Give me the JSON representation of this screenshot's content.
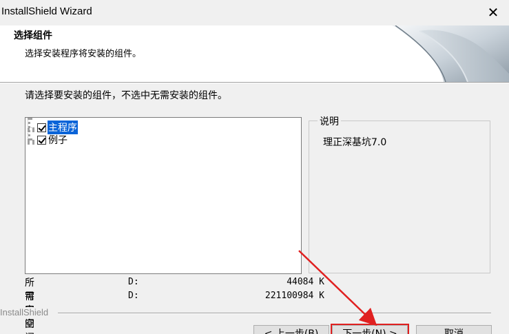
{
  "window": {
    "title": "InstallShield Wizard",
    "close_glyph": "✕"
  },
  "header": {
    "title": "选择组件",
    "subtitle": "选择安装程序将安装的组件。"
  },
  "instruction": "请选择要安装的组件，不选中无需安装的组件。",
  "components": [
    {
      "label": "主程序",
      "checked": true,
      "selected": true
    },
    {
      "label": "例子",
      "checked": true,
      "selected": false
    }
  ],
  "description": {
    "legend": "说明",
    "text": "理正深基坑7.0"
  },
  "space": {
    "required_label": "所需空间",
    "required_drive": "D:",
    "required_value": "44084 K",
    "available_label": "可用空间",
    "available_drive": "D:",
    "available_value": "221100984 K"
  },
  "brand": "InstallShield",
  "buttons": {
    "back": "< 上一步(B)",
    "next": "下一步(N) >",
    "cancel": "取消"
  },
  "colors": {
    "selection": "#0a64d8",
    "highlight": "#e02020"
  }
}
